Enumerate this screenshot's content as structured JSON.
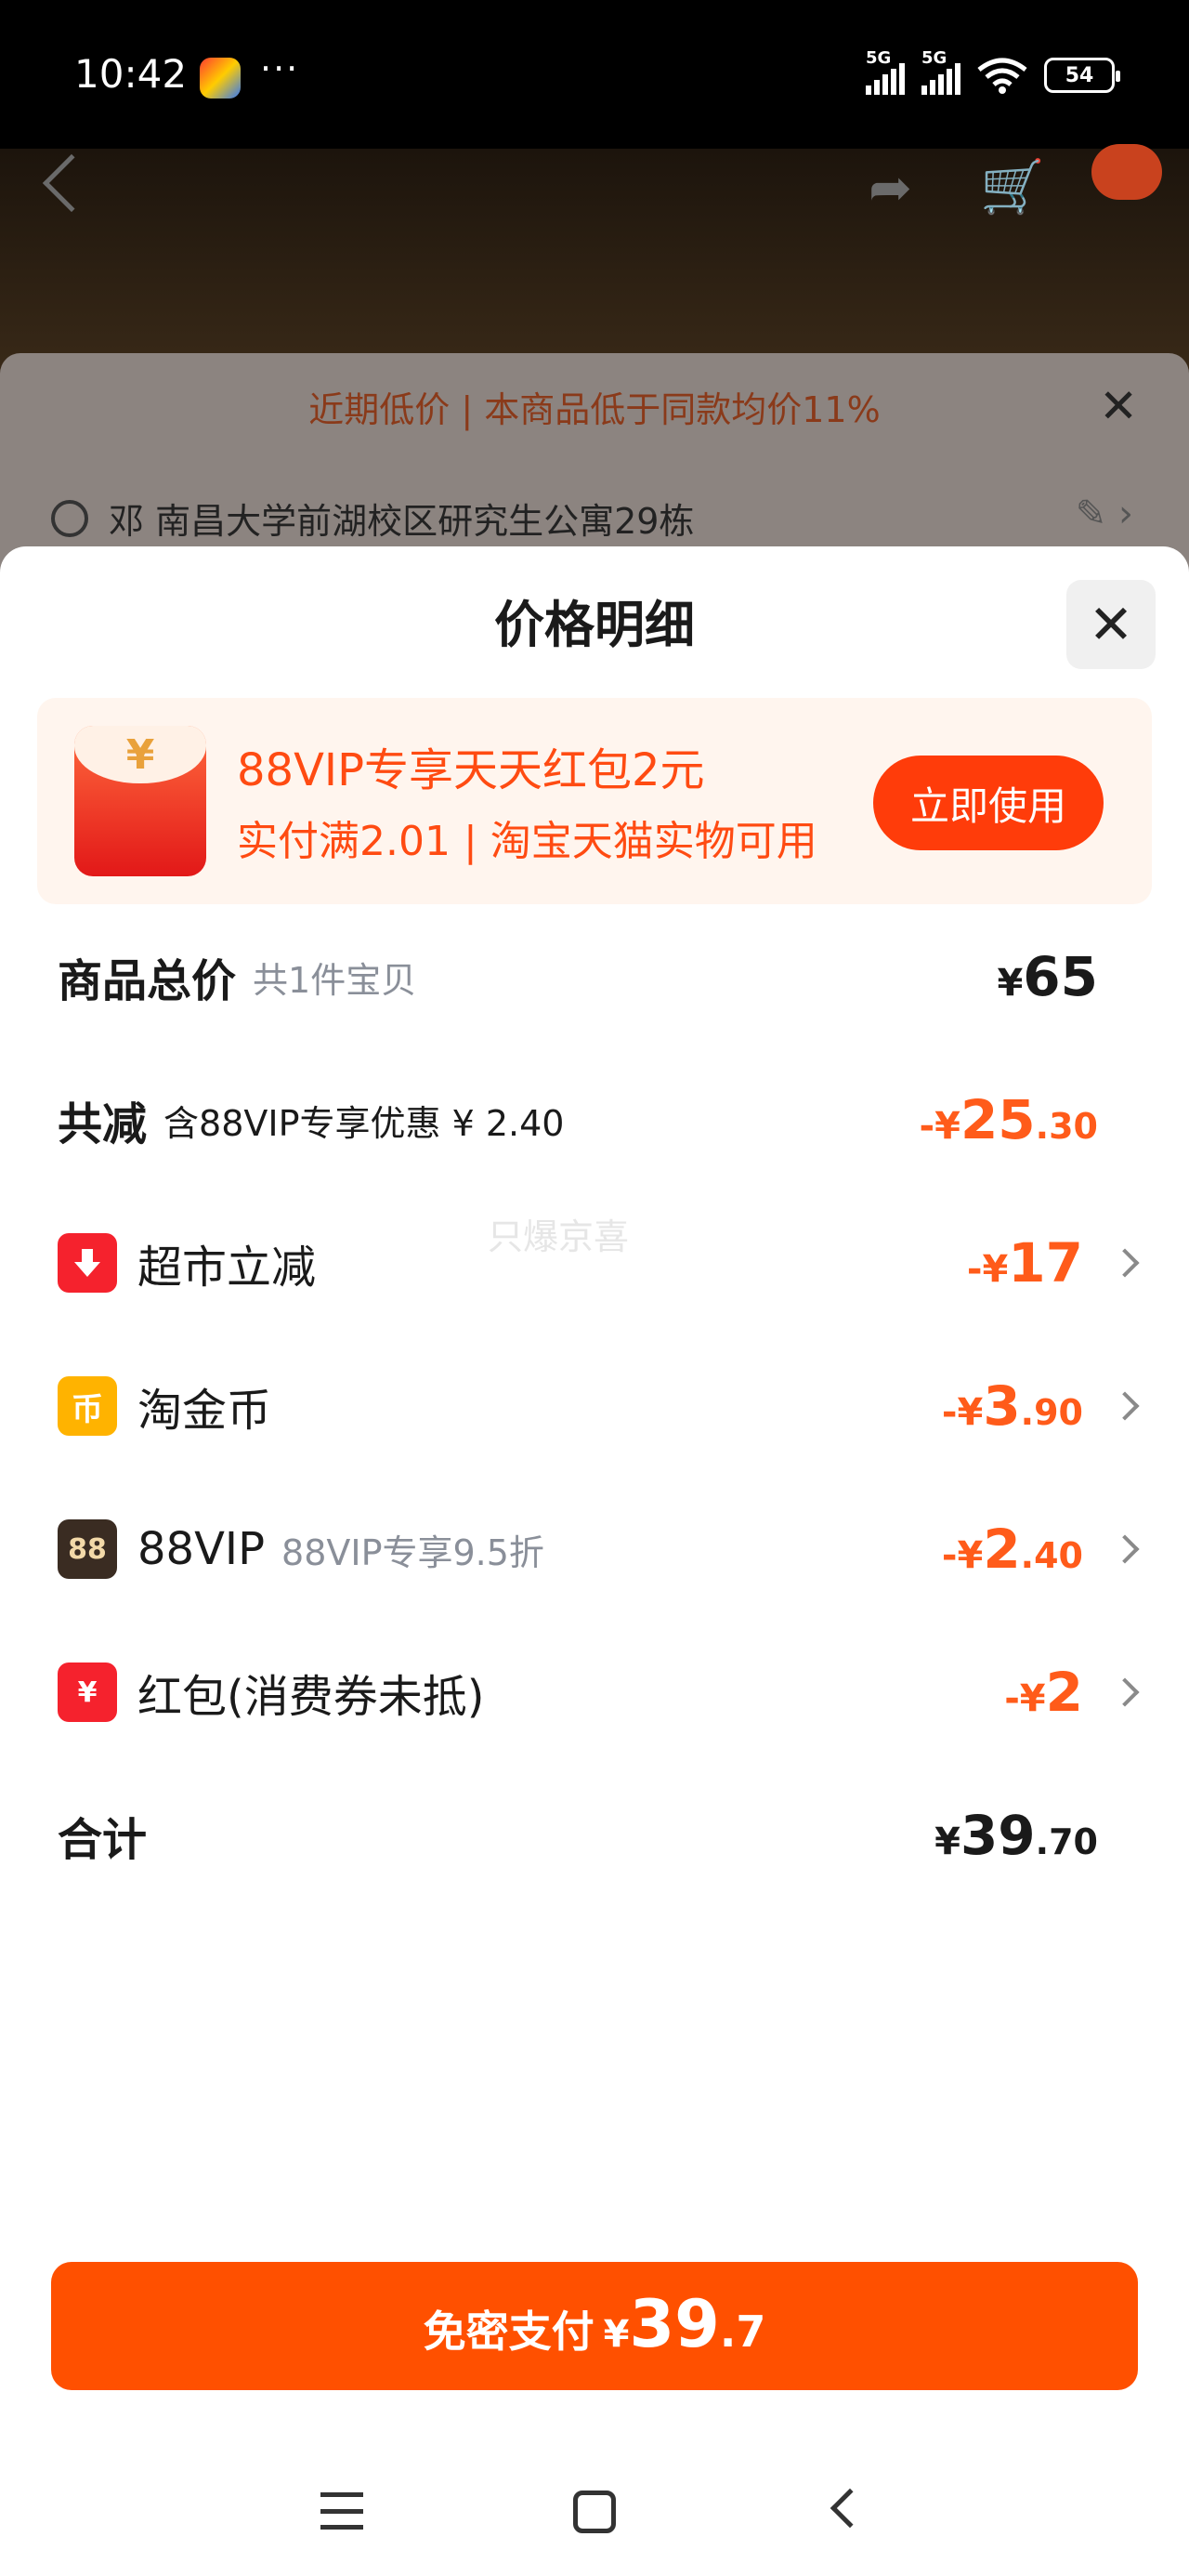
{
  "status_bar": {
    "time": "10:42",
    "more": "···",
    "network1": "5G",
    "network2": "5G",
    "battery": "54"
  },
  "background": {
    "banner_text": "近期低价 | 本商品低于同款均价11%",
    "address": "邓 南昌大学前湖校区研究生公寓29栋"
  },
  "modal": {
    "title": "价格明细",
    "close_icon": "close-icon",
    "promo": {
      "title": "88VIP专享天天红包2元",
      "subtitle": "实付满2.01 | 淘宝天猫实物可用",
      "button": "立即使用",
      "icon_glyph": "¥"
    },
    "rows": [
      {
        "label": "商品总价",
        "sub": "共1件宝贝",
        "currency": "¥",
        "int": "65",
        "dec": ""
      },
      {
        "label": "共减",
        "sub": "含88VIP专享优惠 ¥ 2.40",
        "currency": "-¥",
        "int": "25",
        "dec": ".30"
      },
      {
        "label": "超市立减",
        "icon": "down-arrow-icon",
        "currency": "-¥",
        "int": "17",
        "dec": ""
      },
      {
        "label": "淘金币",
        "icon": "coin-icon",
        "icon_glyph": "币",
        "currency": "-¥",
        "int": "3",
        "dec": ".90"
      },
      {
        "label": "88VIP",
        "sub": "88VIP专享9.5折",
        "icon": "vip-88-icon",
        "icon_glyph": "88",
        "currency": "-¥",
        "int": "2",
        "dec": ".40"
      },
      {
        "label": "红包(消费券未抵)",
        "icon": "red-packet-icon",
        "icon_glyph": "¥",
        "currency": "-¥",
        "int": "2",
        "dec": ""
      },
      {
        "label": "合计",
        "currency": "¥",
        "int": "39",
        "dec": ".70"
      }
    ],
    "watermark": "只爆京喜",
    "pay_button": {
      "label": "免密支付",
      "currency": "¥",
      "int": "39",
      "dec": ".7"
    }
  },
  "colors": {
    "accent": "#ff5000",
    "discount": "#ff5b1a",
    "promo_bg": "#fff5ee"
  }
}
